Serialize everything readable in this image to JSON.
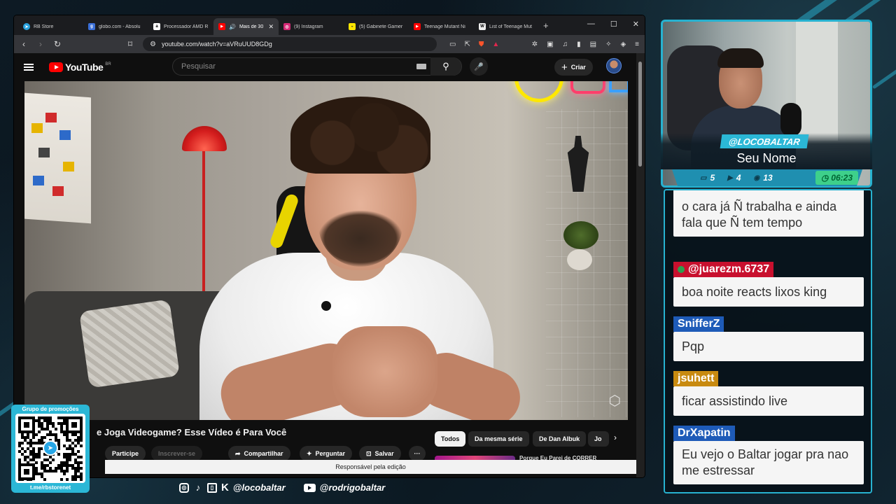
{
  "browser": {
    "tabs": [
      {
        "label": "RB Store",
        "icon": "telegram-icon",
        "color": "#2aa3df",
        "glyph": "➤"
      },
      {
        "label": "globo.com - Absolu",
        "icon": "globo-icon",
        "color": "#3a6fd8",
        "glyph": "g"
      },
      {
        "label": "Processador AMD R",
        "icon": "amazon-icon",
        "color": "#333333",
        "glyph": "a"
      },
      {
        "label": "Mais de 30",
        "icon": "youtube-icon",
        "color": "#ff0000",
        "glyph": "▶",
        "active": true
      },
      {
        "label": "(9) Instagram",
        "icon": "instagram-icon",
        "color": "#d62976",
        "glyph": "◎"
      },
      {
        "label": "(5) Gabinete Gamer",
        "icon": "ml-icon",
        "color": "#ffe600",
        "glyph": "◒"
      },
      {
        "label": "Teenage Mutant Ni",
        "icon": "youtube-icon",
        "color": "#ff0000",
        "glyph": "▶"
      },
      {
        "label": "List of Teenage Mut",
        "icon": "wikipedia-icon",
        "color": "#eeeeee",
        "glyph": "W"
      }
    ],
    "url": "youtube.com/watch?v=aVRuUUD8GDg"
  },
  "youtube": {
    "logo_text": "YouTube",
    "country": "BR",
    "search_placeholder": "Pesquisar",
    "create_label": "Criar",
    "video_title": "e Joga Videogame? Esse Vídeo é Para Você",
    "join_label": "Participe",
    "subscribe_label": "Inscrever-se",
    "share_label": "Compartilhar",
    "ask_label": "Perguntar",
    "save_label": "Salvar",
    "chips": [
      "Todos",
      "Da mesma série",
      "De Dan Albuk",
      "Jo"
    ],
    "rec_title": "Porque Eu Parei de CORRER",
    "tooltip": "Responsável pela edição"
  },
  "stream": {
    "handle": "@LOCOBALTAR",
    "name": "Seu Nome",
    "stats": {
      "chat": "5",
      "video": "4",
      "comments": "13",
      "timer": "06:23"
    },
    "chat": [
      {
        "user": "",
        "text": "o cara já Ñ trabalha e ainda fala que Ñ tem tempo",
        "color": ""
      },
      {
        "user": "@juarezm.6737",
        "text": "boa noite reacts lixos king",
        "color": "#c8102e"
      },
      {
        "user": "SnifferZ",
        "text": "Pqp",
        "color": "#1e5bb8"
      },
      {
        "user": "jsuhett",
        "text": "ficar assistindo live",
        "color": "#c88a10"
      },
      {
        "user": "DrXapatin",
        "text": "Eu vejo o Baltar jogar pra nao me estressar",
        "color": "#1e5bb8"
      }
    ],
    "qr_title": "Grupo de promoções",
    "qr_url": "t.me/rbstorenet",
    "socials": {
      "handle1": "@locobaltar",
      "handle2": "@rodrigobaltar"
    }
  }
}
